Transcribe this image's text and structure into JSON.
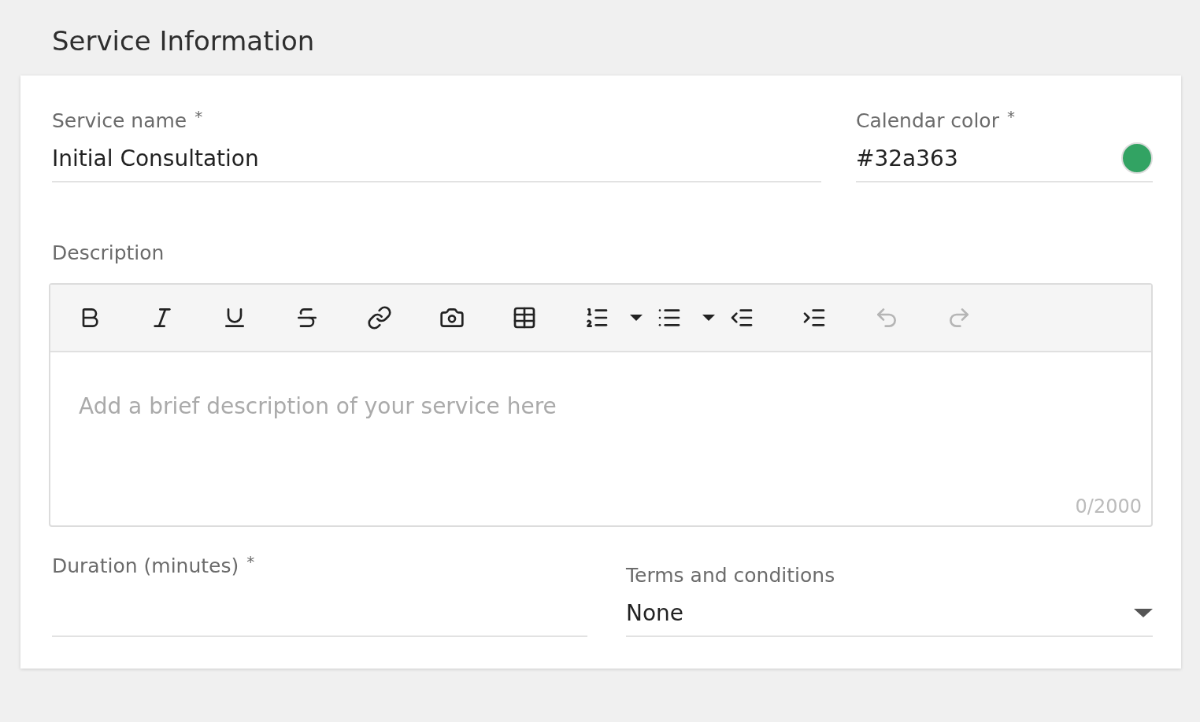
{
  "section_title": "Service Information",
  "service_name": {
    "label": "Service name",
    "required_mark": "*",
    "value": "Initial Consultation"
  },
  "calendar_color": {
    "label": "Calendar color",
    "required_mark": "*",
    "value": "#32a363",
    "color": "#32a363"
  },
  "description": {
    "label": "Description",
    "placeholder": "Add a brief description of your service here",
    "counter": "0/2000",
    "toolbar": [
      {
        "kind": "button",
        "disabled": false
      },
      {
        "kind": "button",
        "disabled": false
      },
      {
        "kind": "button",
        "disabled": false
      },
      {
        "kind": "button",
        "disabled": false
      },
      {
        "kind": "button",
        "disabled": false
      },
      {
        "kind": "button",
        "disabled": false
      },
      {
        "kind": "button",
        "disabled": false
      },
      {
        "kind": "menu-button",
        "disabled": false
      },
      {
        "kind": "menu-button",
        "disabled": false
      },
      {
        "kind": "button",
        "disabled": false
      },
      {
        "kind": "button",
        "disabled": false
      },
      {
        "kind": "button",
        "disabled": true
      },
      {
        "kind": "button",
        "disabled": true
      }
    ]
  },
  "duration": {
    "label": "Duration (minutes)",
    "required_mark": "*"
  },
  "terms": {
    "label": "Terms and conditions",
    "value": "None"
  }
}
